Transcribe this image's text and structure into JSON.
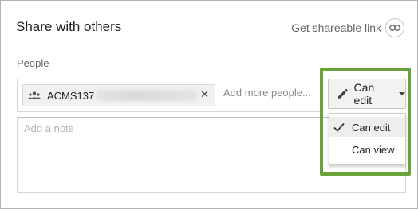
{
  "dialog": {
    "title": "Share with others",
    "shareable_link": {
      "label": "Get shareable link",
      "icon": "link-icon"
    },
    "people": {
      "label": "People",
      "chips": [
        {
          "name": "ACMS137",
          "icon": "group-icon",
          "remove_glyph": "✕"
        }
      ],
      "add_placeholder": "Add more people..."
    },
    "permission": {
      "current": "Can edit",
      "icon": "pencil-icon",
      "options": [
        {
          "label": "Can edit",
          "selected": true
        },
        {
          "label": "Can view",
          "selected": false
        }
      ]
    },
    "note": {
      "placeholder": "Add a note"
    },
    "highlight_color": "#6aa33a"
  }
}
